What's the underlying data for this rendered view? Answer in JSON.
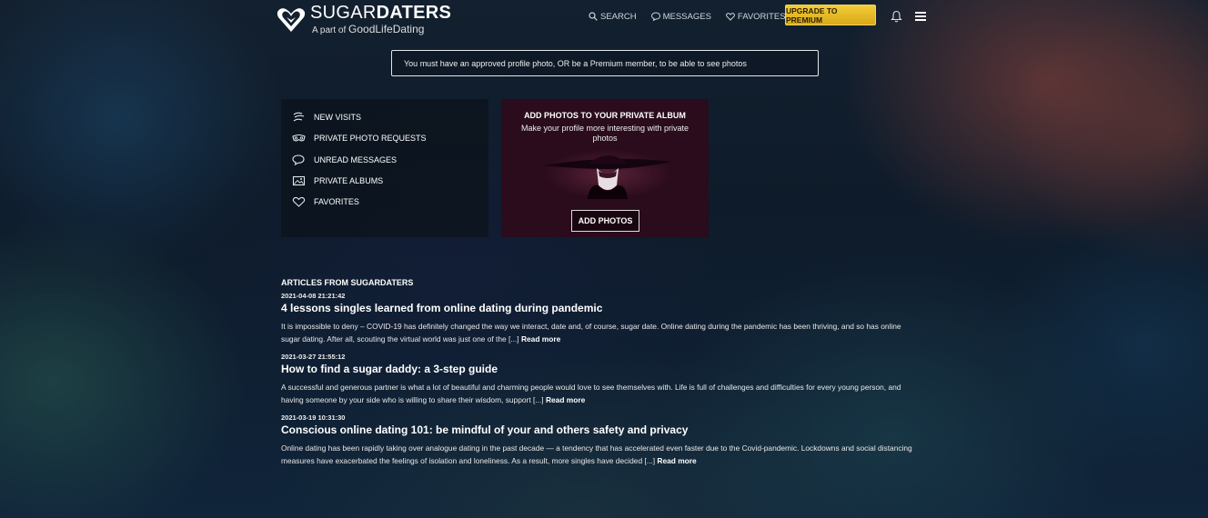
{
  "brand": {
    "name_light": "SUGAR",
    "name_bold": "DATERS",
    "sub_prefix": "A part of",
    "sub_brand": "GoodLifeDating"
  },
  "nav": {
    "search": "SEARCH",
    "messages": "MESSAGES",
    "favorites": "FAVORITES",
    "premium": "UPGRADE TO PREMIUM"
  },
  "notice": "You must have an approved profile photo, OR be a Premium member, to be able to see photos",
  "menu": {
    "items": [
      {
        "label": "NEW VISITS",
        "icon": "visits-icon"
      },
      {
        "label": "PRIVATE PHOTO REQUESTS",
        "icon": "mask-icon"
      },
      {
        "label": "UNREAD MESSAGES",
        "icon": "chat-icon"
      },
      {
        "label": "PRIVATE ALBUMS",
        "icon": "album-icon"
      },
      {
        "label": "FAVORITES",
        "icon": "heart-icon"
      }
    ]
  },
  "album": {
    "title": "ADD PHOTOS TO YOUR PRIVATE ALBUM",
    "subtitle": "Make your profile more interesting with private photos",
    "button": "ADD PHOTOS"
  },
  "articles": {
    "heading": "ARTICLES FROM SUGARDATERS",
    "read_more": "Read more",
    "items": [
      {
        "date": "2021-04-08 21:21:42",
        "title": "4 lessons singles learned from online dating during pandemic",
        "excerpt": "It is impossible to deny – COVID-19 has definitely changed the way we interact, date and, of course, sugar date. Online dating during the pandemic has been thriving, and so has online sugar dating. After all, scouting the virtual world was just one of the [...]"
      },
      {
        "date": "2021-03-27 21:55:12",
        "title": "How to find a sugar daddy: a 3-step guide",
        "excerpt": "A successful and generous partner is what a lot of beautiful and charming people would love to see themselves with. Life is full of challenges and difficulties for every young person, and having someone by your side who is willing to share their wisdom, support [...]"
      },
      {
        "date": "2021-03-19 10:31:30",
        "title": "Conscious online dating 101: be mindful of your and others safety and privacy",
        "excerpt": "Online dating has been rapidly taking over analogue dating in the past decade — a tendency that has accelerated even faster due to the Covid-pandemic. Lockdowns and social distancing measures have exacerbated the feelings of isolation and loneliness. As a result, more singles have decided [...]"
      }
    ]
  },
  "colors": {
    "premium": "#e6b824",
    "album_bg": "#2a0c1c",
    "panel_bg": "#0c141c"
  }
}
